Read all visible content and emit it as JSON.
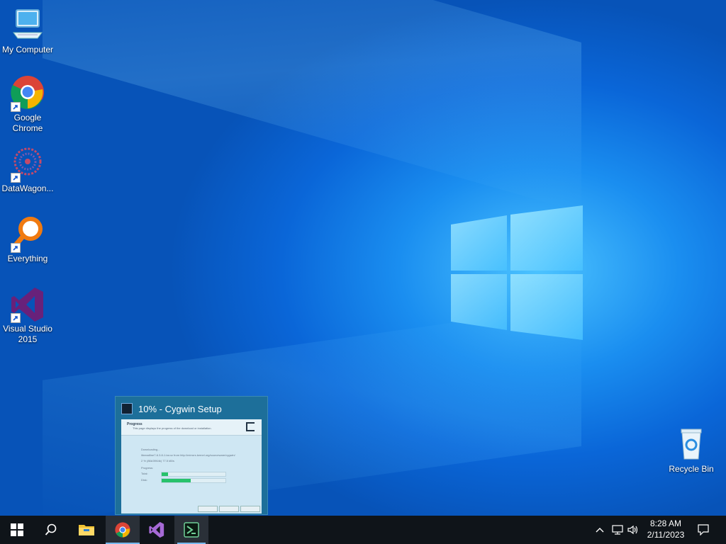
{
  "desktop": {
    "icons": [
      {
        "label": "My Computer",
        "icon": "computer-icon",
        "shortcut": false
      },
      {
        "label": "Google Chrome",
        "icon": "chrome-icon",
        "shortcut": true
      },
      {
        "label": "DataWagon...",
        "icon": "datawagon-icon",
        "shortcut": true
      },
      {
        "label": "Everything",
        "icon": "everything-search-icon",
        "shortcut": true
      },
      {
        "label": "Visual Studio 2015",
        "icon": "visual-studio-icon",
        "shortcut": true
      },
      {
        "label": "Recycle Bin",
        "icon": "recycle-bin-icon",
        "shortcut": false
      }
    ]
  },
  "preview": {
    "title": "10% - Cygwin Setup",
    "header_title": "Progress",
    "header_sub": "This page displays the progress of the download or installation.",
    "line1": "Downloading...",
    "line2": "libreadline7-6.3.8-1.tar.xz from http://mirrors.kernel.org/sourceware/cygwin/",
    "line3": "2 % (86k/3964k) 77.5 kB/s",
    "progress_label": "Progress:",
    "total_label": "Total:",
    "disk_label": "Disk:",
    "total_fraction": 0.1,
    "disk_fraction": 0.45,
    "back_label": "< Back",
    "next_label": "Next >",
    "cancel_label": "Cancel"
  },
  "taskbar": {
    "start": "windows-start-icon",
    "search": "search-icon",
    "apps": [
      {
        "name": "file-explorer-icon",
        "active": false
      },
      {
        "name": "chrome-icon",
        "active": true
      },
      {
        "name": "visual-studio-icon",
        "active": false
      },
      {
        "name": "cygwin-setup-icon",
        "active": true
      }
    ],
    "time": "8:28 AM",
    "date": "2/11/2023"
  },
  "colors": {
    "accent": "#76b9ed",
    "progress": "#27c26b",
    "taskbar": "#0f1419"
  }
}
